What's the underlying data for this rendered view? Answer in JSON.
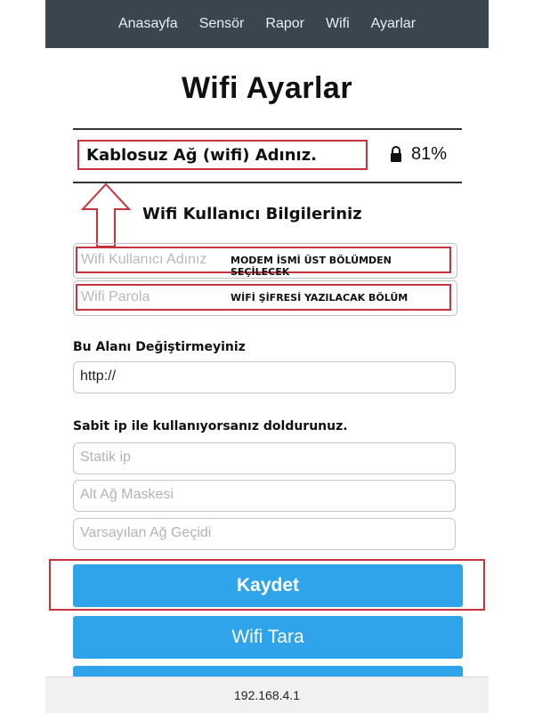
{
  "nav": {
    "items": [
      {
        "label": "Anasayfa"
      },
      {
        "label": "Sensör"
      },
      {
        "label": "Rapor"
      },
      {
        "label": "Wifi"
      },
      {
        "label": "Ayarlar"
      }
    ]
  },
  "page": {
    "title": "Wifi Ayarlar"
  },
  "network": {
    "name": "Kablosuz Ağ (wifi) Adınız.",
    "signal": "81%",
    "lock_icon": "lock-icon"
  },
  "credentials": {
    "heading": "Wifi Kullanıcı Bilgileriniz",
    "username_placeholder": "Wifi Kullanıcı Adınız",
    "username_note": "MODEM İSMİ ÜST BÖLÜMDEN SEÇİLECEK",
    "password_placeholder": "Wifi Parola",
    "password_note": "WİFİ ŞİFRESİ YAZILACAK BÖLÜM"
  },
  "server": {
    "label": "Bu Alanı Değiştirmeyiniz",
    "value": "http://"
  },
  "static_ip": {
    "label": "Sabit ip ile kullanıyorsanız doldurunuz.",
    "ip_placeholder": "Statik ip",
    "mask_placeholder": "Alt Ağ Maskesi",
    "gateway_placeholder": "Varsayılan Ağ Geçidi"
  },
  "actions": {
    "save_label": "Kaydet",
    "scan_label": "Wifi Tara"
  },
  "browser": {
    "address": "192.168.4.1"
  },
  "colors": {
    "nav_bg": "#39454f",
    "button": "#2fa4ea",
    "annotation": "#c8323c"
  }
}
